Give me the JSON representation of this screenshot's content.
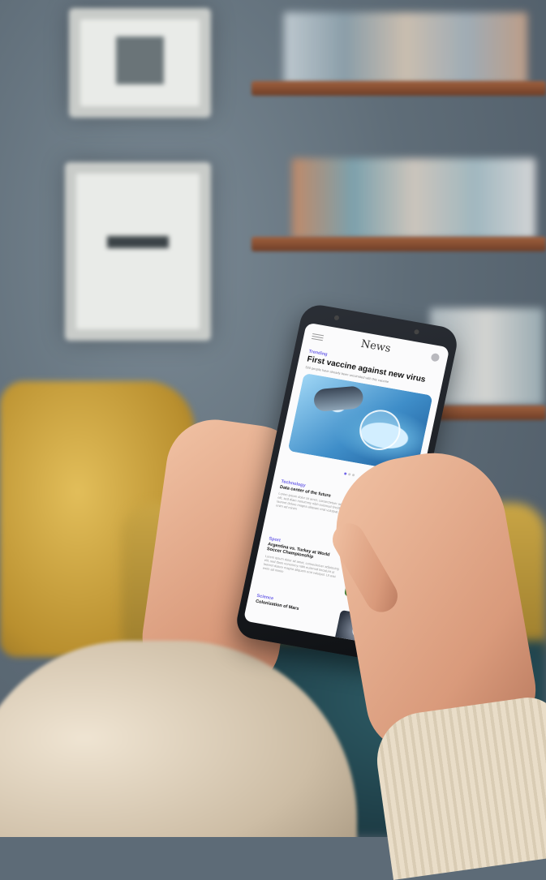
{
  "app": {
    "title": "News"
  },
  "hero": {
    "category": "Trending",
    "headline": "First vaccine against new virus",
    "subtitle": "500 people have already been vaccinated with this vaccine",
    "carousel_dots": [
      true,
      false,
      false
    ]
  },
  "articles": [
    {
      "category": "Technology",
      "title": "Data center of the future",
      "excerpt": "Lorem ipsum dolor sit amet, consectetuer adipiscing elit, sed diam nonummy nibh euismod tincidunt ut laoreet dolore magna aliquam erat volutpat. Ut wisi enim ad minim",
      "thumbnail": "server-room-image"
    },
    {
      "category": "Sport",
      "title": "Argentina vs. Turkey at World Soccer Championship",
      "excerpt": "Lorem ipsum dolor sit amet, consectetuer adipiscing elit, sed diam nonummy nibh euismod tincidunt ut laoreet dolore magna aliquam erat volutpat. Ut wisi enim ad minim",
      "thumbnail": "soccer-image"
    },
    {
      "category": "Science",
      "title": "Colonization of Mars",
      "excerpt": "",
      "thumbnail": "astronaut-image"
    }
  ],
  "colors": {
    "accent": "#6f64e8",
    "screen_bg": "#fbfbfc"
  }
}
